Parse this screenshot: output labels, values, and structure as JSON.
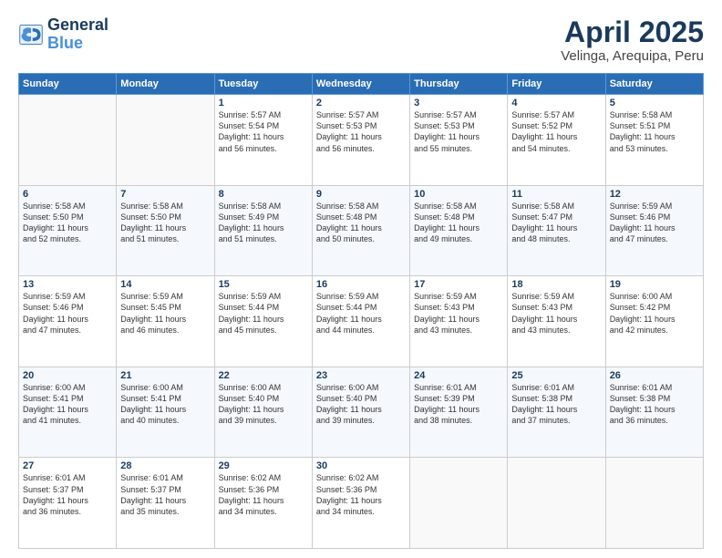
{
  "logo": {
    "line1": "General",
    "line2": "Blue"
  },
  "title": "April 2025",
  "subtitle": "Velinga, Arequipa, Peru",
  "weekdays": [
    "Sunday",
    "Monday",
    "Tuesday",
    "Wednesday",
    "Thursday",
    "Friday",
    "Saturday"
  ],
  "weeks": [
    [
      {
        "day": "",
        "info": ""
      },
      {
        "day": "",
        "info": ""
      },
      {
        "day": "1",
        "info": "Sunrise: 5:57 AM\nSunset: 5:54 PM\nDaylight: 11 hours\nand 56 minutes."
      },
      {
        "day": "2",
        "info": "Sunrise: 5:57 AM\nSunset: 5:53 PM\nDaylight: 11 hours\nand 56 minutes."
      },
      {
        "day": "3",
        "info": "Sunrise: 5:57 AM\nSunset: 5:53 PM\nDaylight: 11 hours\nand 55 minutes."
      },
      {
        "day": "4",
        "info": "Sunrise: 5:57 AM\nSunset: 5:52 PM\nDaylight: 11 hours\nand 54 minutes."
      },
      {
        "day": "5",
        "info": "Sunrise: 5:58 AM\nSunset: 5:51 PM\nDaylight: 11 hours\nand 53 minutes."
      }
    ],
    [
      {
        "day": "6",
        "info": "Sunrise: 5:58 AM\nSunset: 5:50 PM\nDaylight: 11 hours\nand 52 minutes."
      },
      {
        "day": "7",
        "info": "Sunrise: 5:58 AM\nSunset: 5:50 PM\nDaylight: 11 hours\nand 51 minutes."
      },
      {
        "day": "8",
        "info": "Sunrise: 5:58 AM\nSunset: 5:49 PM\nDaylight: 11 hours\nand 51 minutes."
      },
      {
        "day": "9",
        "info": "Sunrise: 5:58 AM\nSunset: 5:48 PM\nDaylight: 11 hours\nand 50 minutes."
      },
      {
        "day": "10",
        "info": "Sunrise: 5:58 AM\nSunset: 5:48 PM\nDaylight: 11 hours\nand 49 minutes."
      },
      {
        "day": "11",
        "info": "Sunrise: 5:58 AM\nSunset: 5:47 PM\nDaylight: 11 hours\nand 48 minutes."
      },
      {
        "day": "12",
        "info": "Sunrise: 5:59 AM\nSunset: 5:46 PM\nDaylight: 11 hours\nand 47 minutes."
      }
    ],
    [
      {
        "day": "13",
        "info": "Sunrise: 5:59 AM\nSunset: 5:46 PM\nDaylight: 11 hours\nand 47 minutes."
      },
      {
        "day": "14",
        "info": "Sunrise: 5:59 AM\nSunset: 5:45 PM\nDaylight: 11 hours\nand 46 minutes."
      },
      {
        "day": "15",
        "info": "Sunrise: 5:59 AM\nSunset: 5:44 PM\nDaylight: 11 hours\nand 45 minutes."
      },
      {
        "day": "16",
        "info": "Sunrise: 5:59 AM\nSunset: 5:44 PM\nDaylight: 11 hours\nand 44 minutes."
      },
      {
        "day": "17",
        "info": "Sunrise: 5:59 AM\nSunset: 5:43 PM\nDaylight: 11 hours\nand 43 minutes."
      },
      {
        "day": "18",
        "info": "Sunrise: 5:59 AM\nSunset: 5:43 PM\nDaylight: 11 hours\nand 43 minutes."
      },
      {
        "day": "19",
        "info": "Sunrise: 6:00 AM\nSunset: 5:42 PM\nDaylight: 11 hours\nand 42 minutes."
      }
    ],
    [
      {
        "day": "20",
        "info": "Sunrise: 6:00 AM\nSunset: 5:41 PM\nDaylight: 11 hours\nand 41 minutes."
      },
      {
        "day": "21",
        "info": "Sunrise: 6:00 AM\nSunset: 5:41 PM\nDaylight: 11 hours\nand 40 minutes."
      },
      {
        "day": "22",
        "info": "Sunrise: 6:00 AM\nSunset: 5:40 PM\nDaylight: 11 hours\nand 39 minutes."
      },
      {
        "day": "23",
        "info": "Sunrise: 6:00 AM\nSunset: 5:40 PM\nDaylight: 11 hours\nand 39 minutes."
      },
      {
        "day": "24",
        "info": "Sunrise: 6:01 AM\nSunset: 5:39 PM\nDaylight: 11 hours\nand 38 minutes."
      },
      {
        "day": "25",
        "info": "Sunrise: 6:01 AM\nSunset: 5:38 PM\nDaylight: 11 hours\nand 37 minutes."
      },
      {
        "day": "26",
        "info": "Sunrise: 6:01 AM\nSunset: 5:38 PM\nDaylight: 11 hours\nand 36 minutes."
      }
    ],
    [
      {
        "day": "27",
        "info": "Sunrise: 6:01 AM\nSunset: 5:37 PM\nDaylight: 11 hours\nand 36 minutes."
      },
      {
        "day": "28",
        "info": "Sunrise: 6:01 AM\nSunset: 5:37 PM\nDaylight: 11 hours\nand 35 minutes."
      },
      {
        "day": "29",
        "info": "Sunrise: 6:02 AM\nSunset: 5:36 PM\nDaylight: 11 hours\nand 34 minutes."
      },
      {
        "day": "30",
        "info": "Sunrise: 6:02 AM\nSunset: 5:36 PM\nDaylight: 11 hours\nand 34 minutes."
      },
      {
        "day": "",
        "info": ""
      },
      {
        "day": "",
        "info": ""
      },
      {
        "day": "",
        "info": ""
      }
    ]
  ]
}
